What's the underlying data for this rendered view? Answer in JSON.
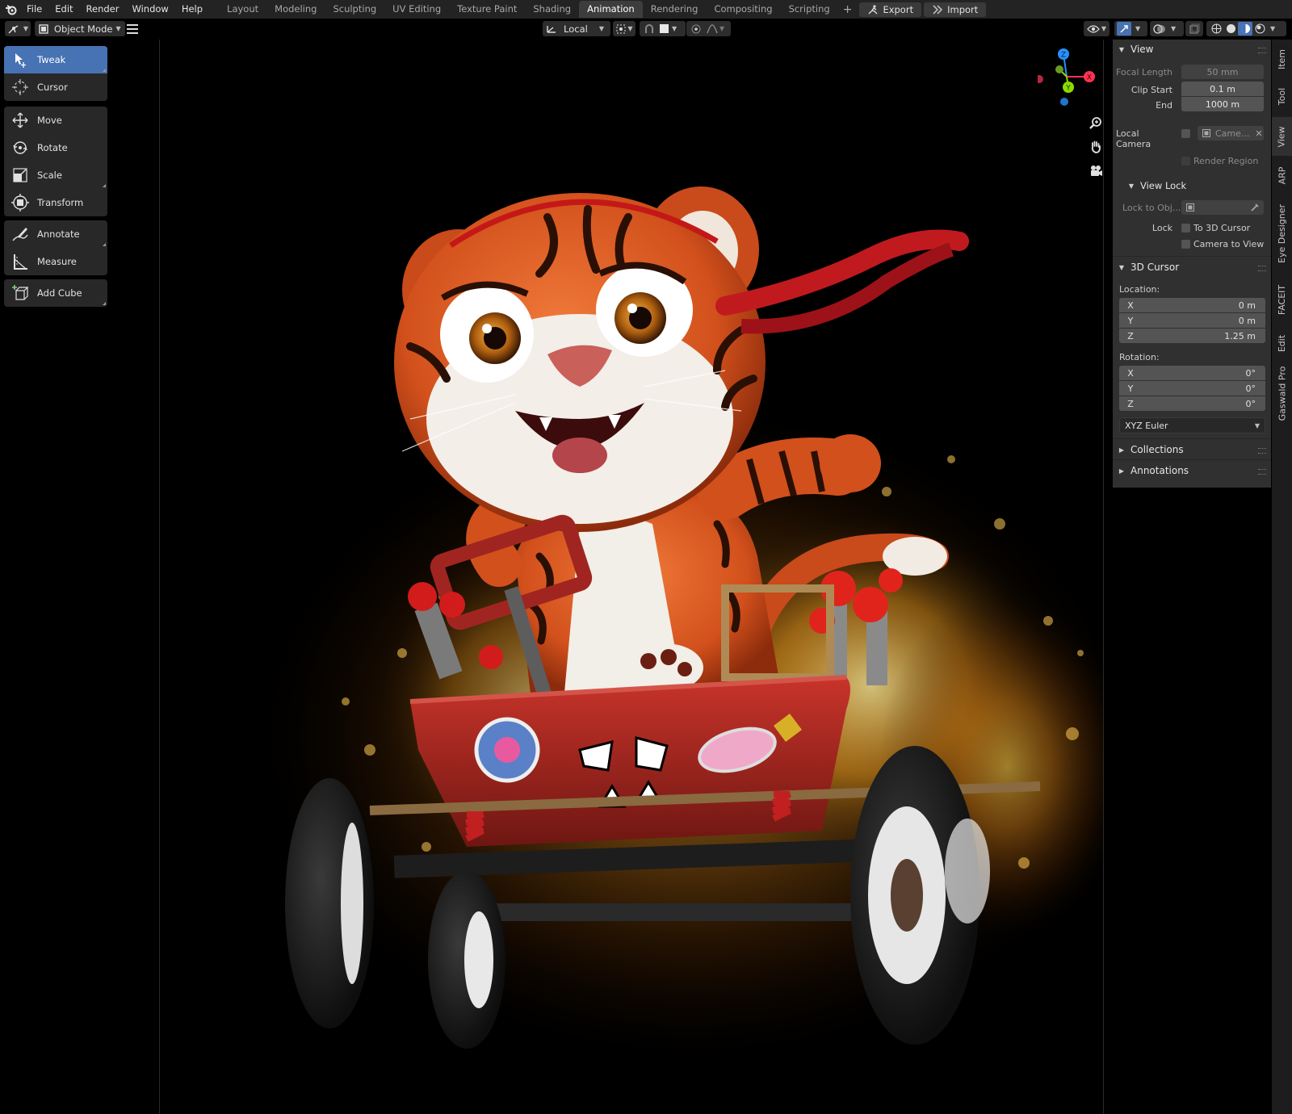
{
  "menubar": {
    "items": [
      "File",
      "Edit",
      "Render",
      "Window",
      "Help"
    ],
    "workspaces": [
      "Layout",
      "Modeling",
      "Sculpting",
      "UV Editing",
      "Texture Paint",
      "Shading",
      "Animation",
      "Rendering",
      "Compositing",
      "Scripting"
    ],
    "active_workspace": "Animation",
    "add_workspace": "+",
    "export_label": "Export",
    "import_label": "Import"
  },
  "header": {
    "mode": "Object Mode",
    "transform_orientation": "Local"
  },
  "toolbar": {
    "tools": [
      "Tweak",
      "Cursor",
      "Move",
      "Rotate",
      "Scale",
      "Transform",
      "Annotate",
      "Measure",
      "Add Cube"
    ],
    "active_tool": "Tweak"
  },
  "gizmo": {
    "x": "X",
    "y": "Y",
    "z": "Z"
  },
  "npanel": {
    "tabs": [
      "Item",
      "Tool",
      "View",
      "ARP",
      "Eye Designer",
      "FACEIT",
      "Edit",
      "Gaswald Pro"
    ],
    "active_tab": "View",
    "view": {
      "title": "View",
      "focal_length_label": "Focal Length",
      "focal_length": "50 mm",
      "clip_start_label": "Clip Start",
      "clip_start": "0.1 m",
      "end_label": "End",
      "end": "1000 m",
      "local_camera_label": "Local Camera",
      "local_camera_value": "Came...",
      "render_region_label": "Render Region",
      "view_lock_title": "View Lock",
      "lock_to_obj_label": "Lock to Obj...",
      "lock_label": "Lock",
      "to_3d_cursor_label": "To 3D Cursor",
      "camera_to_view_label": "Camera to View"
    },
    "cursor": {
      "title": "3D Cursor",
      "location_label": "Location:",
      "location": [
        {
          "axis": "X",
          "value": "0 m"
        },
        {
          "axis": "Y",
          "value": "0 m"
        },
        {
          "axis": "Z",
          "value": "1.25 m"
        }
      ],
      "rotation_label": "Rotation:",
      "rotation": [
        {
          "axis": "X",
          "value": "0°"
        },
        {
          "axis": "Y",
          "value": "0°"
        },
        {
          "axis": "Z",
          "value": "0°"
        }
      ],
      "rotation_mode": "XYZ Euler"
    },
    "collections_title": "Collections",
    "annotations_title": "Annotations"
  },
  "colors": {
    "active_blue": "#4772b3",
    "x_axis": "#ff3352",
    "y_axis": "#8bdc00",
    "z_axis": "#2890ff"
  }
}
